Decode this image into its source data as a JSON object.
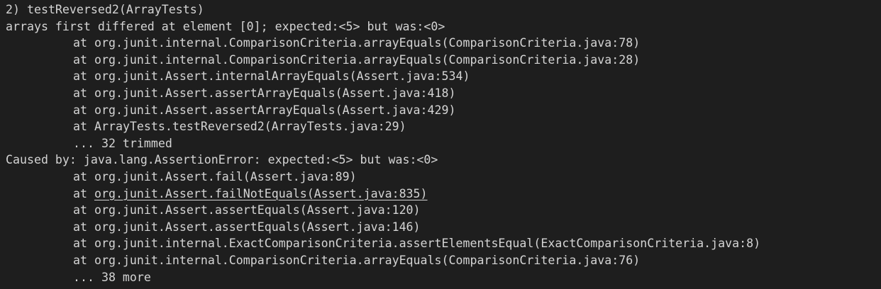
{
  "terminal": {
    "lines": [
      {
        "text": "2) testReversed2(ArrayTests)",
        "indent": false,
        "link": false
      },
      {
        "text": "arrays first differed at element [0]; expected:<5> but was:<0>",
        "indent": false,
        "link": false
      },
      {
        "prefix": "at ",
        "text": "org.junit.internal.ComparisonCriteria.arrayEquals(ComparisonCriteria.java:78)",
        "indent": true,
        "link": false
      },
      {
        "prefix": "at ",
        "text": "org.junit.internal.ComparisonCriteria.arrayEquals(ComparisonCriteria.java:28)",
        "indent": true,
        "link": false
      },
      {
        "prefix": "at ",
        "text": "org.junit.Assert.internalArrayEquals(Assert.java:534)",
        "indent": true,
        "link": false
      },
      {
        "prefix": "at ",
        "text": "org.junit.Assert.assertArrayEquals(Assert.java:418)",
        "indent": true,
        "link": false
      },
      {
        "prefix": "at ",
        "text": "org.junit.Assert.assertArrayEquals(Assert.java:429)",
        "indent": true,
        "link": false
      },
      {
        "prefix": "at ",
        "text": "ArrayTests.testReversed2(ArrayTests.java:29)",
        "indent": true,
        "link": false
      },
      {
        "text": "... 32 trimmed",
        "indent": true,
        "link": false
      },
      {
        "text": "Caused by: java.lang.AssertionError: expected:<5> but was:<0>",
        "indent": false,
        "link": false
      },
      {
        "prefix": "at ",
        "text": "org.junit.Assert.fail(Assert.java:89)",
        "indent": true,
        "link": false
      },
      {
        "prefix": "at ",
        "text": "org.junit.Assert.failNotEquals(Assert.java:835)",
        "indent": true,
        "link": true
      },
      {
        "prefix": "at ",
        "text": "org.junit.Assert.assertEquals(Assert.java:120)",
        "indent": true,
        "link": false
      },
      {
        "prefix": "at ",
        "text": "org.junit.Assert.assertEquals(Assert.java:146)",
        "indent": true,
        "link": false
      },
      {
        "prefix": "at ",
        "text": "org.junit.internal.ExactComparisonCriteria.assertElementsEqual(ExactComparisonCriteria.java:8)",
        "indent": true,
        "link": false
      },
      {
        "prefix": "at ",
        "text": "org.junit.internal.ComparisonCriteria.arrayEquals(ComparisonCriteria.java:76)",
        "indent": true,
        "link": false
      },
      {
        "text": "... 38 more",
        "indent": true,
        "link": false
      }
    ]
  },
  "colors": {
    "background": "#1e1e1e",
    "foreground": "#d4d4d4"
  }
}
